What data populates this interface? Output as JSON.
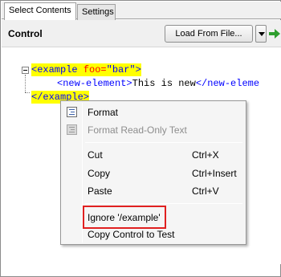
{
  "tabs": [
    {
      "label": "Select Contents",
      "active": true
    },
    {
      "label": "Settings",
      "active": false
    }
  ],
  "toolbar": {
    "control_label": "Control",
    "load_button": "Load From File..."
  },
  "editor": {
    "line1": {
      "open": "<example ",
      "attr": "foo=",
      "value": "\"bar\"",
      "close": ">"
    },
    "line2": {
      "open": "<new-element>",
      "text": "This is new",
      "close": "</new-eleme"
    },
    "line3": {
      "tag": "</example>"
    }
  },
  "context_menu": {
    "items": [
      {
        "label": "Format",
        "shortcut": "",
        "enabled": true,
        "icon": "format-icon"
      },
      {
        "label": "Format Read-Only Text",
        "shortcut": "",
        "enabled": false,
        "icon": "format-readonly-icon"
      },
      {
        "label": "Cut",
        "shortcut": "Ctrl+X",
        "enabled": true
      },
      {
        "label": "Copy",
        "shortcut": "Ctrl+Insert",
        "enabled": true
      },
      {
        "label": "Paste",
        "shortcut": "Ctrl+V",
        "enabled": true
      },
      {
        "label": "Ignore '/example'",
        "shortcut": "",
        "enabled": true,
        "highlighted": true
      },
      {
        "label": "Copy Control to Test",
        "shortcut": "",
        "enabled": true
      }
    ]
  },
  "colors": {
    "highlight_box": "#e02020",
    "xml_highlight": "#ffff00",
    "xml_tag": "#0000ff",
    "xml_attr": "#ff0000",
    "toolbar_arrow": "#2e9e2e"
  }
}
